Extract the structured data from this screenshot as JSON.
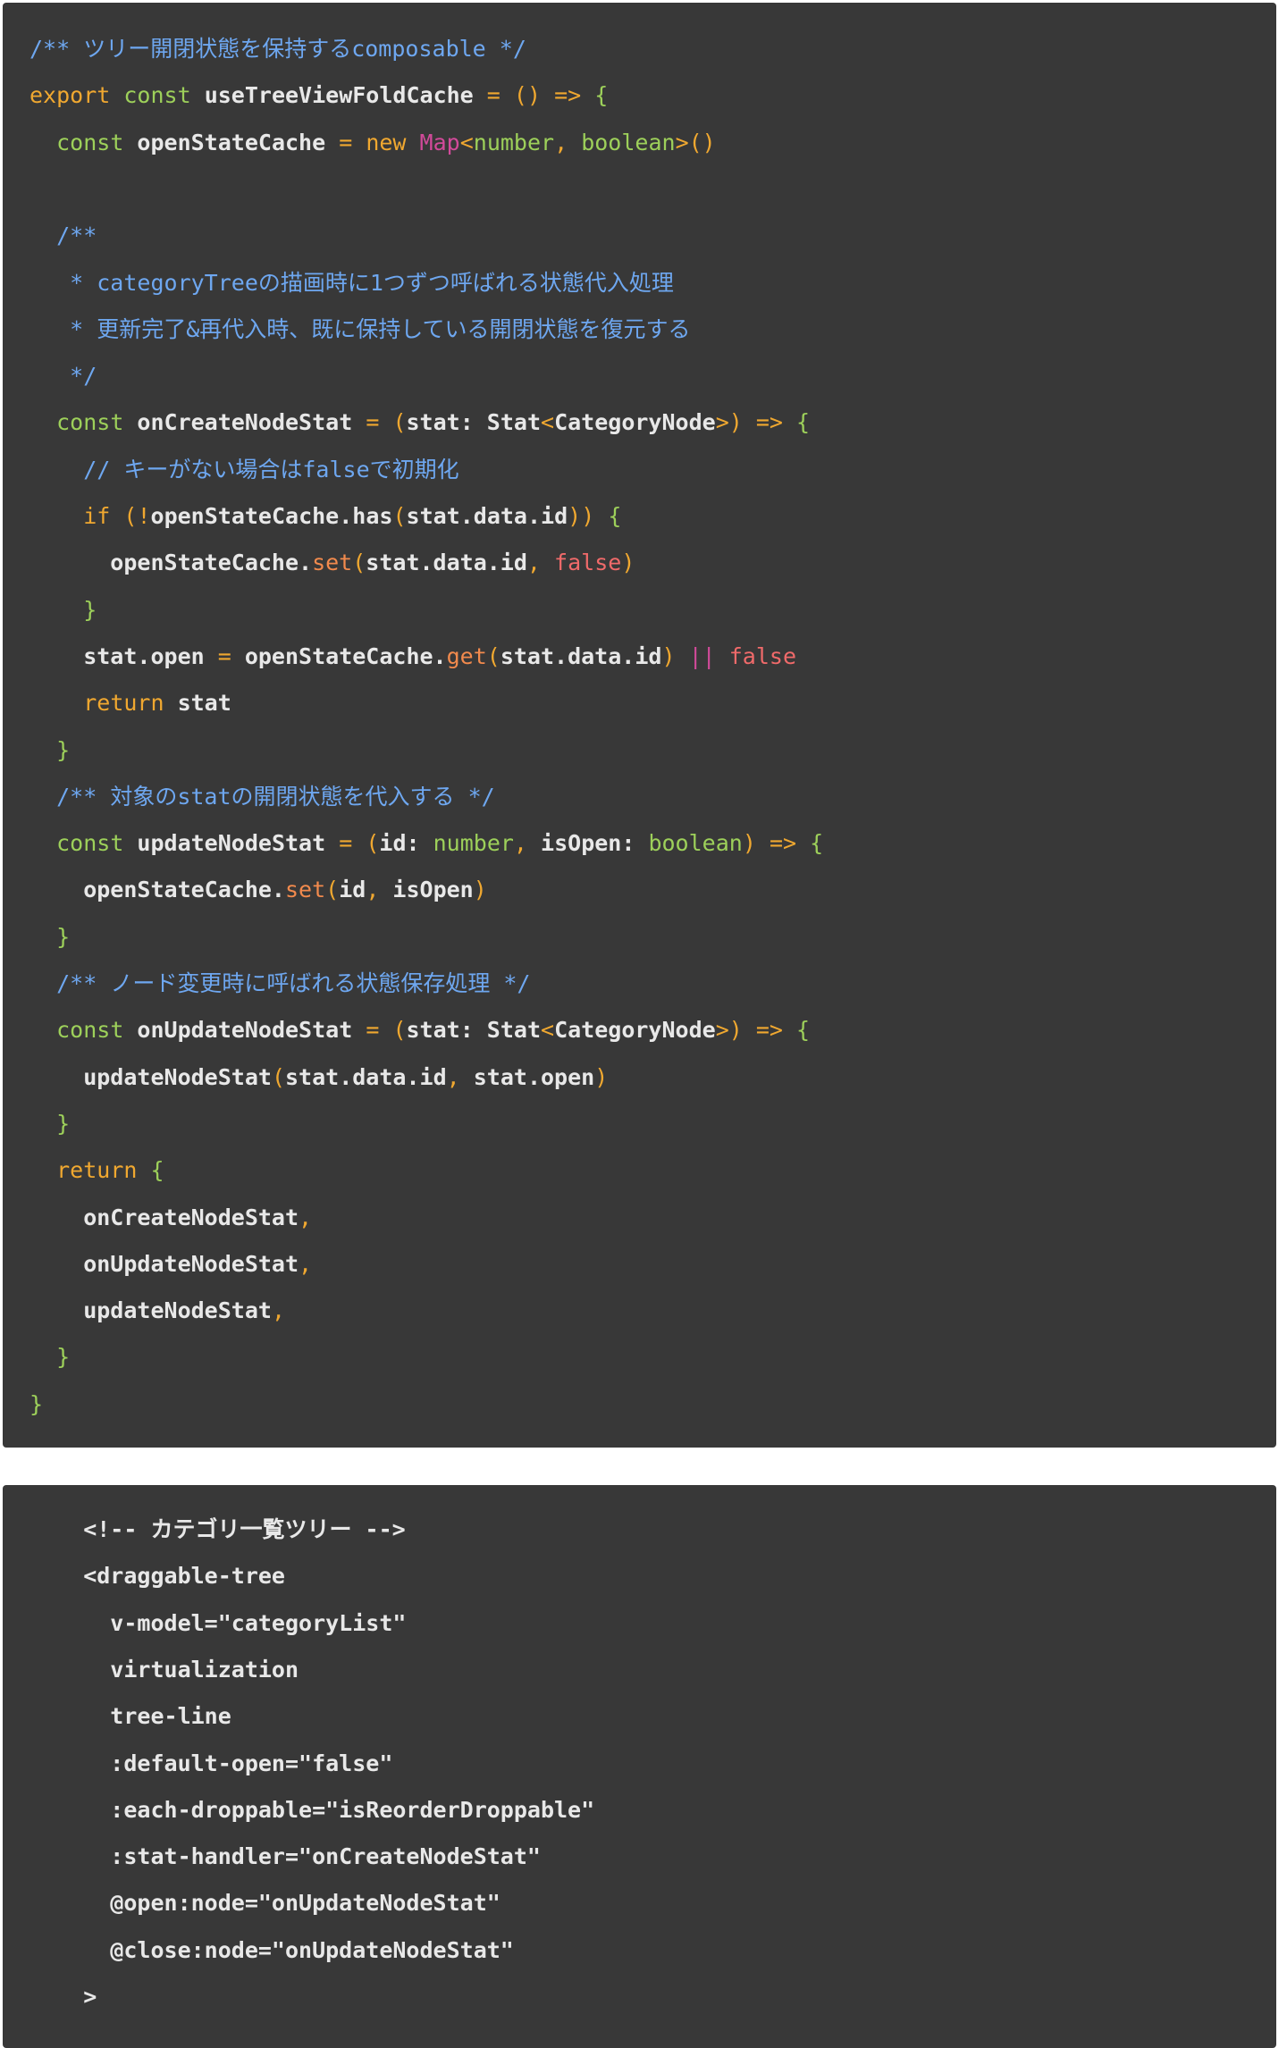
{
  "theme": {
    "background": "#ffffff",
    "code_background": "#383838",
    "comment": "#6ea7f0",
    "keyword": "#f0a830",
    "type": "#9dd05a",
    "builtin_class": "#d24a9a",
    "method": "#f28a4d",
    "literal_false": "#f06a6a",
    "plain": "#e8e8e8"
  },
  "blocks": [
    {
      "language": "typescript",
      "lines": [
        [
          {
            "t": "c",
            "s": "/** ツリー開閉状態を保持するcomposable */"
          }
        ],
        [
          {
            "t": "k",
            "s": "export"
          },
          {
            "t": "w",
            "s": " "
          },
          {
            "t": "g",
            "s": "const"
          },
          {
            "t": "w",
            "s": " useTreeViewFoldCache "
          },
          {
            "t": "k",
            "s": "="
          },
          {
            "t": "w",
            "s": " "
          },
          {
            "t": "p",
            "s": "()"
          },
          {
            "t": "w",
            "s": " "
          },
          {
            "t": "k",
            "s": "=>"
          },
          {
            "t": "w",
            "s": " "
          },
          {
            "t": "g",
            "s": "{"
          }
        ],
        [
          {
            "t": "w",
            "s": "  "
          },
          {
            "t": "g",
            "s": "const"
          },
          {
            "t": "w",
            "s": " openStateCache "
          },
          {
            "t": "k",
            "s": "="
          },
          {
            "t": "w",
            "s": " "
          },
          {
            "t": "k",
            "s": "new"
          },
          {
            "t": "w",
            "s": " "
          },
          {
            "t": "m",
            "s": "Map"
          },
          {
            "t": "p",
            "s": "<"
          },
          {
            "t": "g",
            "s": "number"
          },
          {
            "t": "p",
            "s": ","
          },
          {
            "t": "w",
            "s": " "
          },
          {
            "t": "g",
            "s": "boolean"
          },
          {
            "t": "p",
            "s": ">()"
          }
        ],
        [],
        [
          {
            "t": "w",
            "s": "  "
          },
          {
            "t": "c",
            "s": "/**"
          }
        ],
        [
          {
            "t": "w",
            "s": "   "
          },
          {
            "t": "c",
            "s": "* categoryTreeの描画時に1つずつ呼ばれる状態代入処理"
          }
        ],
        [
          {
            "t": "w",
            "s": "   "
          },
          {
            "t": "c",
            "s": "* 更新完了&再代入時、既に保持している開閉状態を復元する"
          }
        ],
        [
          {
            "t": "w",
            "s": "   "
          },
          {
            "t": "c",
            "s": "*/"
          }
        ],
        [
          {
            "t": "w",
            "s": "  "
          },
          {
            "t": "g",
            "s": "const"
          },
          {
            "t": "w",
            "s": " onCreateNodeStat "
          },
          {
            "t": "k",
            "s": "="
          },
          {
            "t": "w",
            "s": " "
          },
          {
            "t": "p",
            "s": "("
          },
          {
            "t": "w",
            "s": "stat: Stat"
          },
          {
            "t": "p",
            "s": "<"
          },
          {
            "t": "w",
            "s": "CategoryNode"
          },
          {
            "t": "p",
            "s": ">)"
          },
          {
            "t": "w",
            "s": " "
          },
          {
            "t": "k",
            "s": "=>"
          },
          {
            "t": "w",
            "s": " "
          },
          {
            "t": "g",
            "s": "{"
          }
        ],
        [
          {
            "t": "w",
            "s": "    "
          },
          {
            "t": "c",
            "s": "// キーがない場合はfalseで初期化"
          }
        ],
        [
          {
            "t": "w",
            "s": "    "
          },
          {
            "t": "k",
            "s": "if"
          },
          {
            "t": "w",
            "s": " "
          },
          {
            "t": "p",
            "s": "("
          },
          {
            "t": "k",
            "s": "!"
          },
          {
            "t": "w",
            "s": "openStateCache.has"
          },
          {
            "t": "p",
            "s": "("
          },
          {
            "t": "w",
            "s": "stat.data.id"
          },
          {
            "t": "p",
            "s": "))"
          },
          {
            "t": "w",
            "s": " "
          },
          {
            "t": "g",
            "s": "{"
          }
        ],
        [
          {
            "t": "w",
            "s": "      openStateCache."
          },
          {
            "t": "f",
            "s": "set"
          },
          {
            "t": "p",
            "s": "("
          },
          {
            "t": "w",
            "s": "stat.data.id"
          },
          {
            "t": "p",
            "s": ","
          },
          {
            "t": "w",
            "s": " "
          },
          {
            "t": "r",
            "s": "false"
          },
          {
            "t": "p",
            "s": ")"
          }
        ],
        [
          {
            "t": "w",
            "s": "    "
          },
          {
            "t": "g",
            "s": "}"
          }
        ],
        [
          {
            "t": "w",
            "s": "    stat.open "
          },
          {
            "t": "k",
            "s": "="
          },
          {
            "t": "w",
            "s": " openStateCache."
          },
          {
            "t": "f",
            "s": "get"
          },
          {
            "t": "p",
            "s": "("
          },
          {
            "t": "w",
            "s": "stat.data.id"
          },
          {
            "t": "p",
            "s": ")"
          },
          {
            "t": "w",
            "s": " "
          },
          {
            "t": "m",
            "s": "||"
          },
          {
            "t": "w",
            "s": " "
          },
          {
            "t": "r",
            "s": "false"
          }
        ],
        [
          {
            "t": "w",
            "s": "    "
          },
          {
            "t": "k",
            "s": "return"
          },
          {
            "t": "w",
            "s": " stat"
          }
        ],
        [
          {
            "t": "w",
            "s": "  "
          },
          {
            "t": "g",
            "s": "}"
          }
        ],
        [
          {
            "t": "w",
            "s": "  "
          },
          {
            "t": "c",
            "s": "/** 対象のstatの開閉状態を代入する */"
          }
        ],
        [
          {
            "t": "w",
            "s": "  "
          },
          {
            "t": "g",
            "s": "const"
          },
          {
            "t": "w",
            "s": " updateNodeStat "
          },
          {
            "t": "k",
            "s": "="
          },
          {
            "t": "w",
            "s": " "
          },
          {
            "t": "p",
            "s": "("
          },
          {
            "t": "w",
            "s": "id: "
          },
          {
            "t": "g",
            "s": "number"
          },
          {
            "t": "p",
            "s": ","
          },
          {
            "t": "w",
            "s": " isOpen: "
          },
          {
            "t": "g",
            "s": "boolean"
          },
          {
            "t": "p",
            "s": ")"
          },
          {
            "t": "w",
            "s": " "
          },
          {
            "t": "k",
            "s": "=>"
          },
          {
            "t": "w",
            "s": " "
          },
          {
            "t": "g",
            "s": "{"
          }
        ],
        [
          {
            "t": "w",
            "s": "    openStateCache."
          },
          {
            "t": "f",
            "s": "set"
          },
          {
            "t": "p",
            "s": "("
          },
          {
            "t": "w",
            "s": "id"
          },
          {
            "t": "p",
            "s": ","
          },
          {
            "t": "w",
            "s": " isOpen"
          },
          {
            "t": "p",
            "s": ")"
          }
        ],
        [
          {
            "t": "w",
            "s": "  "
          },
          {
            "t": "g",
            "s": "}"
          }
        ],
        [
          {
            "t": "w",
            "s": "  "
          },
          {
            "t": "c",
            "s": "/** ノード変更時に呼ばれる状態保存処理 */"
          }
        ],
        [
          {
            "t": "w",
            "s": "  "
          },
          {
            "t": "g",
            "s": "const"
          },
          {
            "t": "w",
            "s": " onUpdateNodeStat "
          },
          {
            "t": "k",
            "s": "="
          },
          {
            "t": "w",
            "s": " "
          },
          {
            "t": "p",
            "s": "("
          },
          {
            "t": "w",
            "s": "stat: Stat"
          },
          {
            "t": "p",
            "s": "<"
          },
          {
            "t": "w",
            "s": "CategoryNode"
          },
          {
            "t": "p",
            "s": ">)"
          },
          {
            "t": "w",
            "s": " "
          },
          {
            "t": "k",
            "s": "=>"
          },
          {
            "t": "w",
            "s": " "
          },
          {
            "t": "g",
            "s": "{"
          }
        ],
        [
          {
            "t": "w",
            "s": "    updateNodeStat"
          },
          {
            "t": "p",
            "s": "("
          },
          {
            "t": "w",
            "s": "stat.data.id"
          },
          {
            "t": "p",
            "s": ","
          },
          {
            "t": "w",
            "s": " stat.open"
          },
          {
            "t": "p",
            "s": ")"
          }
        ],
        [
          {
            "t": "w",
            "s": "  "
          },
          {
            "t": "g",
            "s": "}"
          }
        ],
        [
          {
            "t": "w",
            "s": "  "
          },
          {
            "t": "k",
            "s": "return"
          },
          {
            "t": "w",
            "s": " "
          },
          {
            "t": "g",
            "s": "{"
          }
        ],
        [
          {
            "t": "w",
            "s": "    onCreateNodeStat"
          },
          {
            "t": "p",
            "s": ","
          }
        ],
        [
          {
            "t": "w",
            "s": "    onUpdateNodeStat"
          },
          {
            "t": "p",
            "s": ","
          }
        ],
        [
          {
            "t": "w",
            "s": "    updateNodeStat"
          },
          {
            "t": "p",
            "s": ","
          }
        ],
        [
          {
            "t": "w",
            "s": "  "
          },
          {
            "t": "g",
            "s": "}"
          }
        ],
        [
          {
            "t": "g",
            "s": "}"
          }
        ]
      ]
    },
    {
      "language": "html",
      "lines": [
        [
          {
            "t": "w",
            "s": "    <!-- カテゴリ一覧ツリー -->"
          }
        ],
        [
          {
            "t": "w",
            "s": "    <draggable-tree"
          }
        ],
        [
          {
            "t": "w",
            "s": "      v-model=\"categoryList\""
          }
        ],
        [
          {
            "t": "w",
            "s": "      virtualization"
          }
        ],
        [
          {
            "t": "w",
            "s": "      tree-line"
          }
        ],
        [
          {
            "t": "w",
            "s": "      :default-open=\"false\""
          }
        ],
        [
          {
            "t": "w",
            "s": "      :each-droppable=\"isReorderDroppable\""
          }
        ],
        [
          {
            "t": "w",
            "s": "      :stat-handler=\"onCreateNodeStat\""
          }
        ],
        [
          {
            "t": "w",
            "s": "      @open:node=\"onUpdateNodeStat\""
          }
        ],
        [
          {
            "t": "w",
            "s": "      @close:node=\"onUpdateNodeStat\""
          }
        ],
        [
          {
            "t": "w",
            "s": "    >"
          }
        ]
      ]
    }
  ]
}
